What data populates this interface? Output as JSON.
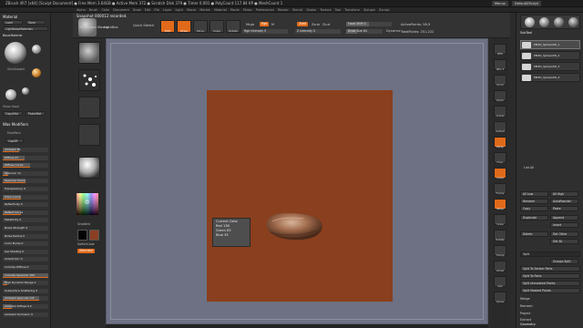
{
  "window": {
    "title": "ZBrush 4R7 [x64] [Sculpt Document] ● Free Mem 3.64GB ● Active Mem 372 ● Scratch Disk 379 ● Timer 0.001 ● PolyCount 117.84 KP ● MeshCount 1",
    "menu_label": "Menus",
    "script_label": "DefaultZScript"
  },
  "menubar": [
    "Alpha",
    "Brush",
    "Color",
    "Document",
    "Draw",
    "Edit",
    "File",
    "Layer",
    "Light",
    "Macro",
    "Marker",
    "Material",
    "Movie",
    "Picker",
    "Preferences",
    "Render",
    "Stencil",
    "Stroke",
    "Texture",
    "Tool",
    "Transform",
    "Zplugin",
    "Zscript"
  ],
  "topshelf": {
    "status": "Snapshot 000012 recorded.",
    "buttons": [
      "Edit",
      "Draw",
      "Move",
      "Scale",
      "Rotate"
    ],
    "projection_master": "Projection Master",
    "lightbox": "LightBox",
    "quick_sketch": "Quick Sketch",
    "mrgb": "Mrgb",
    "rgb": "Rgb",
    "m": "M",
    "zadd": "Zadd",
    "zsub": "Zsub",
    "zcut": "Zcut",
    "rgb_intensity": "Rgb Intensity 0",
    "z_intensity": "Z Intensity 0",
    "focal_shift": "Focal Shift 0",
    "draw_size": "Draw Size 64",
    "dynamic": "Dynamic",
    "active_points": "ActivePoints: 58,9",
    "total_points": "TotalPoints: 251,222"
  },
  "leftpanel": {
    "title": "Material",
    "load": "Load",
    "save": "Save",
    "lightbox_materials": "Lightbox▸Materials",
    "basic_material": "BasicMaterial",
    "skin_shade": "SkinShade4",
    "show_used": "Show Used",
    "copy_mat": "CopyMat",
    "paste_mat": "PasteMat",
    "wax_modifiers": "Wax Modifiers",
    "modifiers": "Modifiers",
    "cavity": "CapSR",
    "sliders": [
      {
        "label": "Ambient 36",
        "value": 0.36
      },
      {
        "label": "Diffuse 47",
        "value": 0.47
      },
      {
        "label": "Diffuse Curve",
        "value": 0.6
      },
      {
        "label": "Specular 11",
        "value": 0.11
      },
      {
        "label": "Specular Curve",
        "value": 0.5
      },
      {
        "label": "Transparency 0",
        "value": 0.0
      },
      {
        "label": "Trans Curve",
        "value": 0.4
      },
      {
        "label": "Reflectivity 0",
        "value": 0.0
      },
      {
        "label": "Reflect Curve",
        "value": 0.4
      },
      {
        "label": "Metallicity 0",
        "value": 0.0
      },
      {
        "label": "Noise Strength 0",
        "value": 0.0
      },
      {
        "label": "Noise Radius 0",
        "value": 0.0
      },
      {
        "label": "Color Bump 0",
        "value": 0.0
      },
      {
        "label": "Gel Shading 0",
        "value": 0.0
      },
      {
        "label": "Anisotropic 0",
        "value": 0.0
      },
      {
        "label": "Colorize Diffuse 0",
        "value": 0.0
      },
      {
        "label": "Colorize Specular 100",
        "value": 1.0
      },
      {
        "label": "High Dynamic Range 1",
        "value": 0.1
      },
      {
        "label": "Subsurface Scattering 0",
        "value": 0.0
      },
      {
        "label": "Ambient Specular 0.8",
        "value": 0.8
      },
      {
        "label": "Ambient Diffuse 0.2",
        "value": 0.2
      },
      {
        "label": "Ambient Occlusion 0",
        "value": 0.0
      }
    ]
  },
  "toolstrip": {
    "gradient": "Gradient",
    "switch_color": "SwitchColor",
    "alternate": "Alternate"
  },
  "tooltip": {
    "title": "Current Color",
    "red": "Red 138",
    "green": "Green 63",
    "blue": "Blue 35"
  },
  "colors": {
    "accent": "#e06a1a",
    "current_color": "#8a3f23",
    "canvas": "#6d7183",
    "document": "#8a3f1e"
  },
  "rightstrip": [
    "BPR",
    "SPix 3",
    "Scroll",
    "Zoom",
    "Actual",
    "AAHalf",
    "Persp",
    "Floor",
    "Local",
    "Frame",
    "Move",
    "Scale",
    "Rotate",
    "Transp",
    "Ghost",
    "Solo",
    "Xpose"
  ],
  "rightpanel": {
    "subtool_title": "SubTool",
    "list_all": "List All",
    "subtools": [
      "PM3D_Sphere3D_1",
      "PM3D_Sphere3D_2",
      "PM3D_Sphere3D_3",
      "PM3D_Sphere3D_4"
    ],
    "all_low": "All Low",
    "all_high": "All High",
    "rename": "Rename",
    "auto_reorder": "AutoReorder",
    "copy": "Copy",
    "paste": "Paste",
    "duplicate": "Duplicate",
    "append": "Append",
    "insert": "Insert",
    "delete": "Delete",
    "del_other": "Del Other",
    "del_all": "Del All",
    "split": "Split",
    "groups_split": "Groups Split",
    "split_similar": "Split To Similar Parts",
    "split_parts": "Split To Parts",
    "split_unmasked": "Split Unmasked Points",
    "split_masked": "Split Masked Points",
    "merge": "Merge",
    "remesh": "Remesh",
    "project": "Project",
    "extract": "Extract",
    "geometry": "Geometry"
  }
}
